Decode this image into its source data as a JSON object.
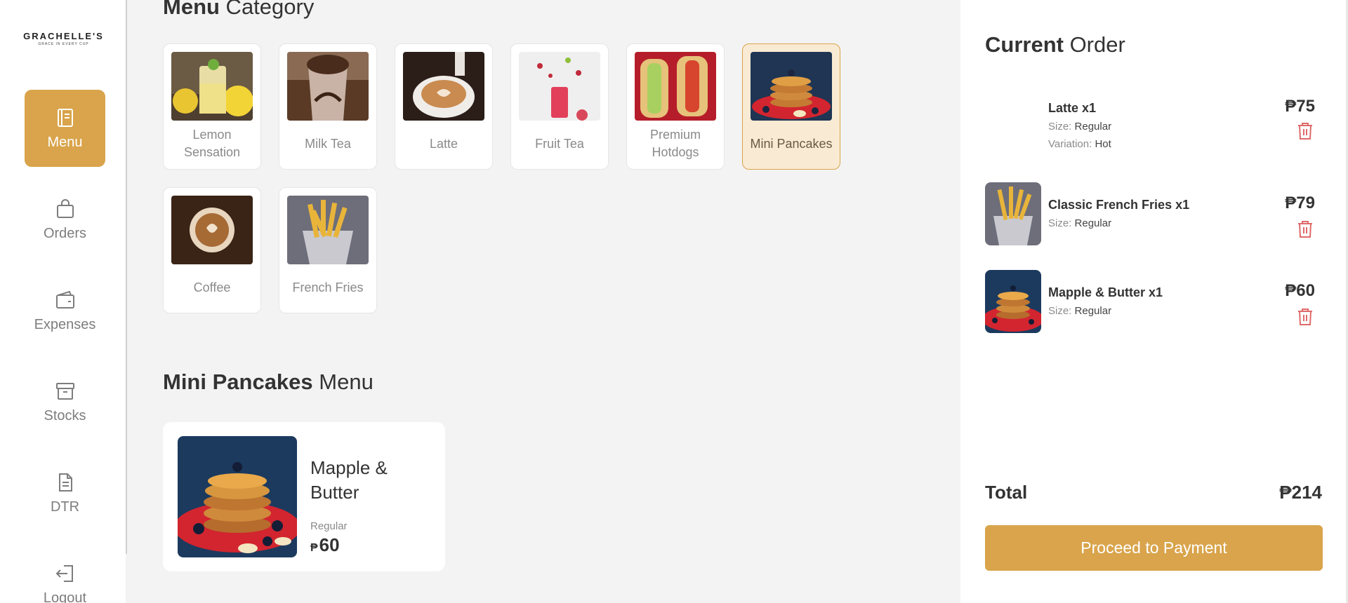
{
  "brand": {
    "name": "GRACHELLE'S",
    "tagline": "GRACE IN EVERY CUP"
  },
  "nav": [
    {
      "label": "Menu",
      "icon": "menu-book-icon",
      "active": true
    },
    {
      "label": "Orders",
      "icon": "bag-icon"
    },
    {
      "label": "Expenses",
      "icon": "wallet-icon"
    },
    {
      "label": "Stocks",
      "icon": "archive-box-icon"
    },
    {
      "label": "DTR",
      "icon": "document-icon"
    },
    {
      "label": "Logout",
      "icon": "logout-icon"
    }
  ],
  "category_section": {
    "title_bold": "Menu",
    "title_rest": " Category"
  },
  "categories": [
    {
      "label": "Lemon Sensation"
    },
    {
      "label": "Milk Tea"
    },
    {
      "label": "Latte"
    },
    {
      "label": "Fruit Tea"
    },
    {
      "label": "Premium Hotdogs"
    },
    {
      "label": "Mini Pancakes",
      "selected": true
    },
    {
      "label": "Coffee"
    },
    {
      "label": "French Fries"
    }
  ],
  "menu_section": {
    "title_bold": "Mini Pancakes",
    "title_rest": " Menu"
  },
  "menu_items": [
    {
      "name": "Mapple & Butter",
      "size": "Regular",
      "currency": "₱",
      "price": "60"
    }
  ],
  "order": {
    "title_bold": "Current",
    "title_rest": " Order",
    "size_label": "Size:",
    "variation_label": "Variation:",
    "items": [
      {
        "title": "Latte x1",
        "size": "Regular",
        "variation": "Hot",
        "price": "₱75"
      },
      {
        "title": "Classic French Fries x1",
        "size": "Regular",
        "price": "₱79"
      },
      {
        "title": "Mapple & Butter x1",
        "size": "Regular",
        "price": "₱60"
      }
    ],
    "total_label": "Total",
    "total_value": "₱214",
    "pay_label": "Proceed to Payment"
  },
  "colors": {
    "accent": "#d9a44b",
    "selected_bg": "#f9ead4",
    "delete": "#e06a6a"
  }
}
